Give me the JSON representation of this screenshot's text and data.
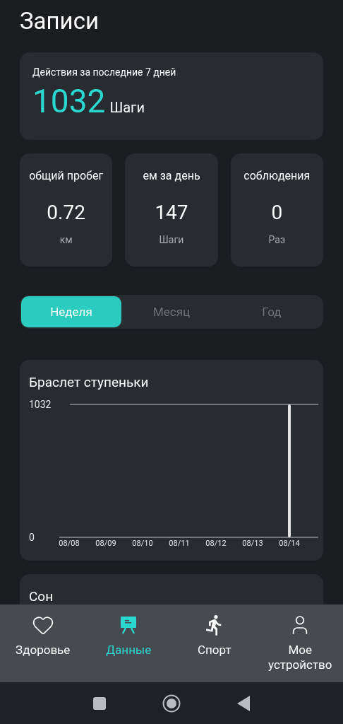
{
  "title": "Записи",
  "summary": {
    "caption": "Действия за последние 7 дней",
    "value": "1032",
    "unit": "Шаги"
  },
  "stats": [
    {
      "label": "общий пробег",
      "value": "0.72",
      "unit": "км"
    },
    {
      "label": "ем за день",
      "value": "147",
      "unit": "Шаги"
    },
    {
      "label": "соблюдения",
      "value": "0",
      "unit": "Раз"
    }
  ],
  "periods": [
    {
      "label": "Неделя",
      "selected": true
    },
    {
      "label": "Месяц",
      "selected": false
    },
    {
      "label": "Год",
      "selected": false
    }
  ],
  "steps_chart": {
    "title": "Браслет ступеньки",
    "chart_data": {
      "type": "bar",
      "categories": [
        "08/08",
        "08/09",
        "08/10",
        "08/11",
        "08/12",
        "08/13",
        "08/14"
      ],
      "values": [
        0,
        0,
        0,
        0,
        0,
        0,
        1032
      ],
      "ylim": [
        0,
        1032
      ],
      "yticks": [
        0,
        1032
      ]
    }
  },
  "sleep": {
    "title": "Сон"
  },
  "nav": [
    {
      "kind": "heart",
      "label": "Здоровье",
      "selected": false
    },
    {
      "kind": "board",
      "label": "Данные",
      "selected": true
    },
    {
      "kind": "runner",
      "label": "Спорт",
      "selected": false
    },
    {
      "kind": "person",
      "label": "Мое устройство",
      "selected": false
    }
  ],
  "system_nav": [
    {
      "kind": "recents"
    },
    {
      "kind": "home"
    },
    {
      "kind": "back"
    }
  ]
}
